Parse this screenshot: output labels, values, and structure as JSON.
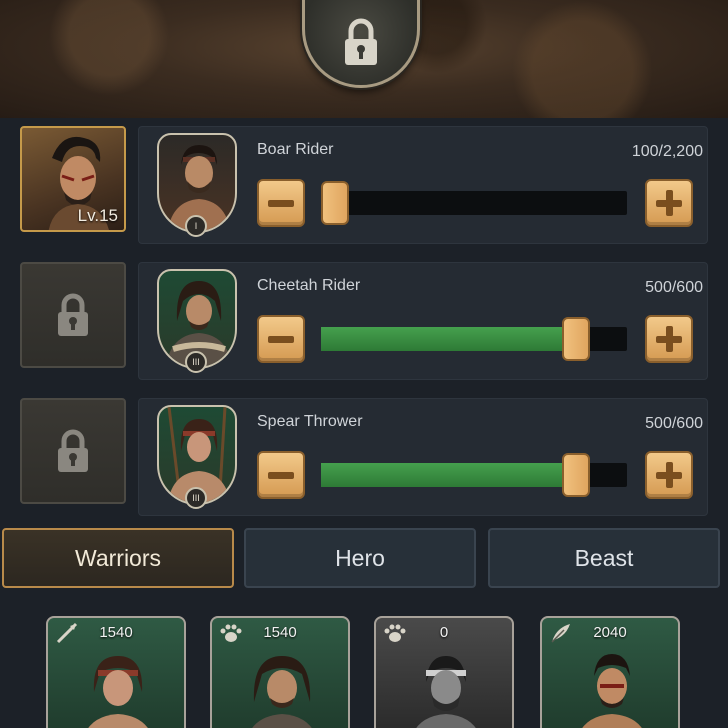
{
  "troops": [
    {
      "name": "Boar Rider",
      "count": "100/2,200",
      "fill": 0.045,
      "rank": "I"
    },
    {
      "name": "Cheetah Rider",
      "count": "500/600",
      "fill": 0.833,
      "rank": "III"
    },
    {
      "name": "Spear Thrower",
      "count": "500/600",
      "fill": 0.833,
      "rank": "III"
    }
  ],
  "hero": {
    "level": "Lv.15"
  },
  "tabs": [
    {
      "label": "Warriors",
      "active": true
    },
    {
      "label": "Hero",
      "active": false
    },
    {
      "label": "Beast",
      "active": false
    }
  ],
  "cards": [
    {
      "count": "1540",
      "icon": "spear-icon"
    },
    {
      "count": "1540",
      "icon": "paw-icon"
    },
    {
      "count": "0",
      "icon": "paw-icon"
    },
    {
      "count": "2040",
      "icon": "feather-icon"
    }
  ],
  "colors": {
    "accent": "#d59a52",
    "progress": "#3a8d42",
    "background": "#1c2128"
  }
}
